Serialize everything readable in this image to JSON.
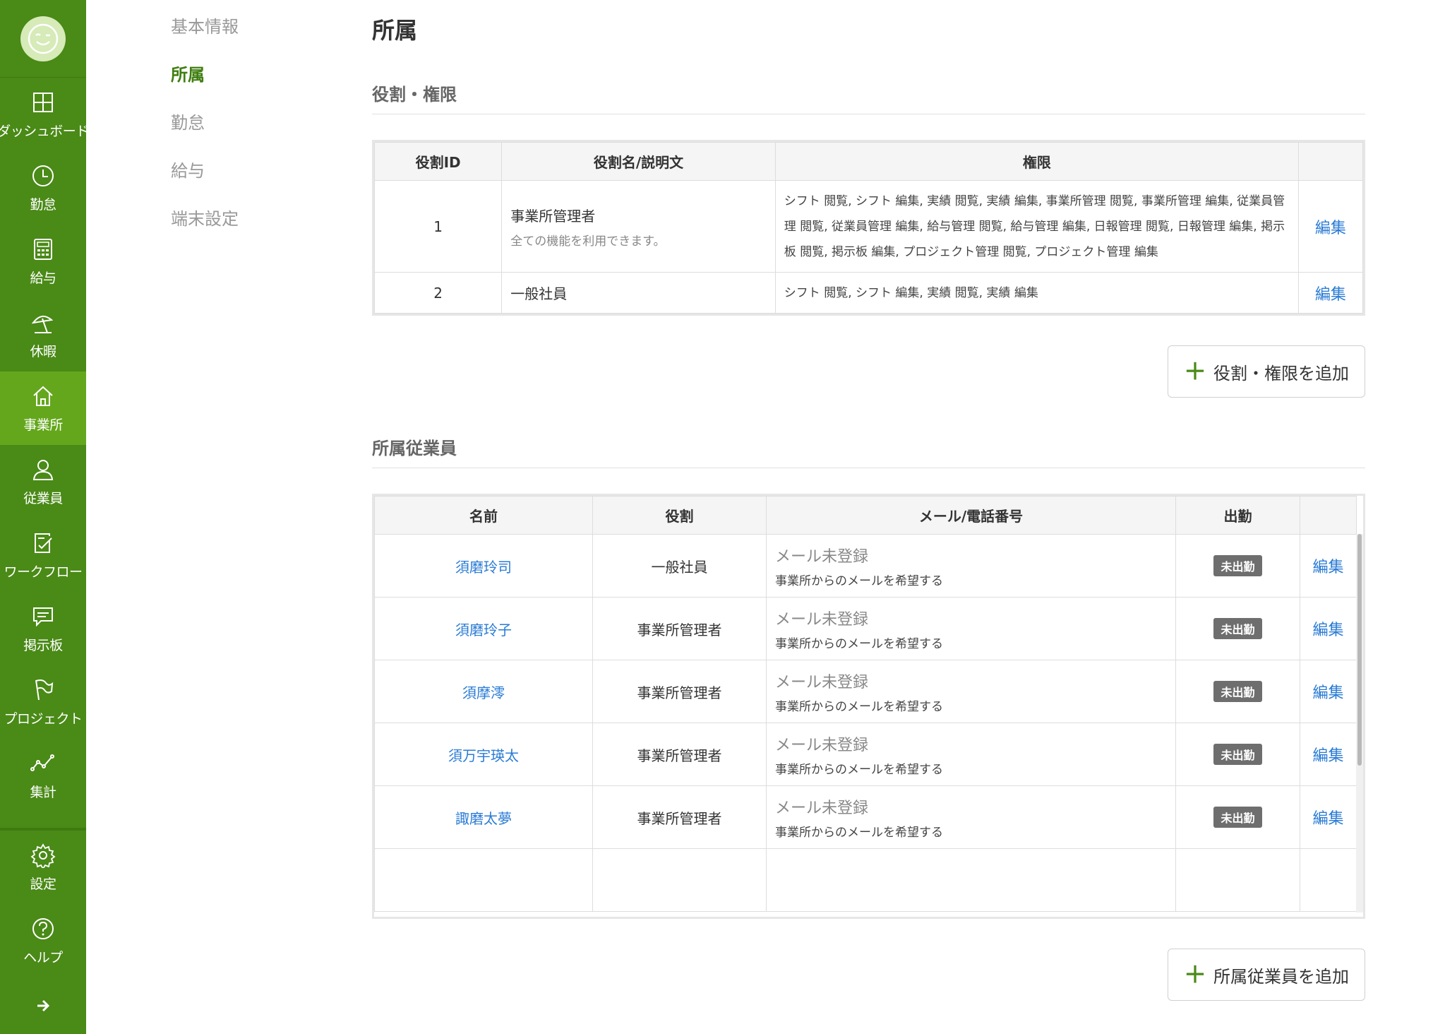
{
  "sidebar": {
    "items": [
      {
        "label": "ダッシュボード",
        "icon": "dashboard-icon"
      },
      {
        "label": "勤怠",
        "icon": "clock-icon"
      },
      {
        "label": "給与",
        "icon": "calculator-icon"
      },
      {
        "label": "休暇",
        "icon": "parasol-icon"
      },
      {
        "label": "事業所",
        "icon": "home-icon"
      },
      {
        "label": "従業員",
        "icon": "person-icon"
      },
      {
        "label": "ワークフロー",
        "icon": "checklist-icon"
      },
      {
        "label": "掲示板",
        "icon": "chat-icon"
      },
      {
        "label": "プロジェクト",
        "icon": "flag-icon"
      },
      {
        "label": "集計",
        "icon": "line-chart-icon"
      }
    ],
    "bottom": [
      {
        "label": "設定",
        "icon": "gear-icon"
      },
      {
        "label": "ヘルプ",
        "icon": "help-icon"
      }
    ],
    "active_index": 4,
    "accent": "#4a8a17",
    "active_bg": "#64a71c"
  },
  "subnav": {
    "items": [
      "基本情報",
      "所属",
      "勤怠",
      "給与",
      "端末設定"
    ],
    "active_index": 1
  },
  "page_title": "所属",
  "roles": {
    "title": "役割・権限",
    "headers": [
      "役割ID",
      "役割名/説明文",
      "権限",
      ""
    ],
    "rows": [
      {
        "id": "1",
        "name": "事業所管理者",
        "description": "全ての機能を利用できます。",
        "permissions": "シフト 閲覧, シフト 編集, 実績 閲覧, 実績 編集, 事業所管理 閲覧, 事業所管理 編集, 従業員管理 閲覧, 従業員管理 編集, 給与管理 閲覧, 給与管理 編集, 日報管理 閲覧, 日報管理 編集, 掲示板 閲覧, 掲示板 編集, プロジェクト管理 閲覧, プロジェクト管理 編集",
        "edit": "編集"
      },
      {
        "id": "2",
        "name": "一般社員",
        "description": "",
        "permissions": "シフト 閲覧, シフト 編集, 実績 閲覧, 実績 編集",
        "edit": "編集"
      }
    ],
    "add_button": "役割・権限を追加"
  },
  "employees": {
    "title": "所属従業員",
    "headers": [
      "名前",
      "役割",
      "メール/電話番号",
      "出勤",
      ""
    ],
    "rows": [
      {
        "name": "須磨玲司",
        "role": "一般社員",
        "mail": "メール未登録",
        "mail_note": "事業所からのメールを希望する",
        "status": "未出勤",
        "edit": "編集"
      },
      {
        "name": "須磨玲子",
        "role": "事業所管理者",
        "mail": "メール未登録",
        "mail_note": "事業所からのメールを希望する",
        "status": "未出勤",
        "edit": "編集"
      },
      {
        "name": "須摩澪",
        "role": "事業所管理者",
        "mail": "メール未登録",
        "mail_note": "事業所からのメールを希望する",
        "status": "未出勤",
        "edit": "編集"
      },
      {
        "name": "須万宇瑛太",
        "role": "事業所管理者",
        "mail": "メール未登録",
        "mail_note": "事業所からのメールを希望する",
        "status": "未出勤",
        "edit": "編集"
      },
      {
        "name": "諏磨太夢",
        "role": "事業所管理者",
        "mail": "メール未登録",
        "mail_note": "事業所からのメールを希望する",
        "status": "未出勤",
        "edit": "編集"
      }
    ],
    "add_button": "所属従業員を追加"
  }
}
